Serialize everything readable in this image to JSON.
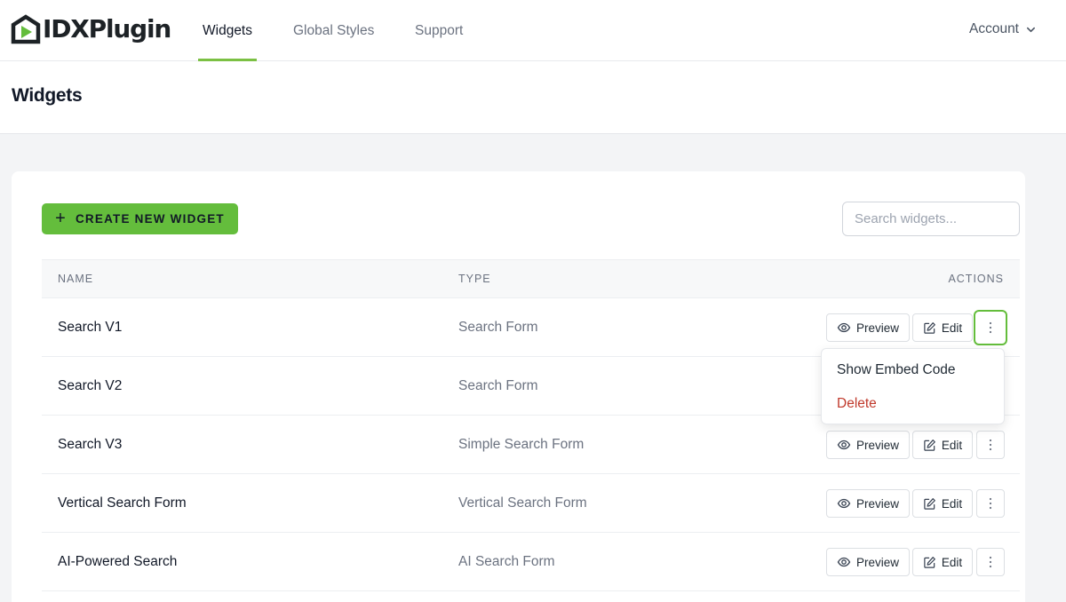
{
  "app": {
    "logo_text": "IDXPlugin"
  },
  "nav": {
    "tabs": [
      {
        "label": "Widgets",
        "active": true
      },
      {
        "label": "Global Styles",
        "active": false
      },
      {
        "label": "Support",
        "active": false
      }
    ],
    "account_label": "Account"
  },
  "page": {
    "title": "Widgets"
  },
  "toolbar": {
    "create_label": "CREATE NEW WIDGET",
    "search_placeholder": "Search widgets..."
  },
  "table": {
    "columns": [
      "NAME",
      "TYPE",
      "ACTIONS"
    ],
    "rows": [
      {
        "name": "Search V1",
        "type": "Search Form"
      },
      {
        "name": "Search V2",
        "type": "Search Form"
      },
      {
        "name": "Search V3",
        "type": "Simple Search Form"
      },
      {
        "name": "Vertical Search Form",
        "type": "Vertical Search Form"
      },
      {
        "name": "AI-Powered Search",
        "type": "AI Search Form"
      }
    ],
    "preview_label": "Preview",
    "edit_label": "Edit"
  },
  "dropdown": {
    "embed_label": "Show Embed Code",
    "delete_label": "Delete"
  },
  "colors": {
    "accent": "#64bd3c",
    "danger": "#c0392b"
  },
  "icons": [
    "logo-icon",
    "chevron-down-icon",
    "plus-icon",
    "eye-icon",
    "edit-icon",
    "more-vertical-icon"
  ]
}
